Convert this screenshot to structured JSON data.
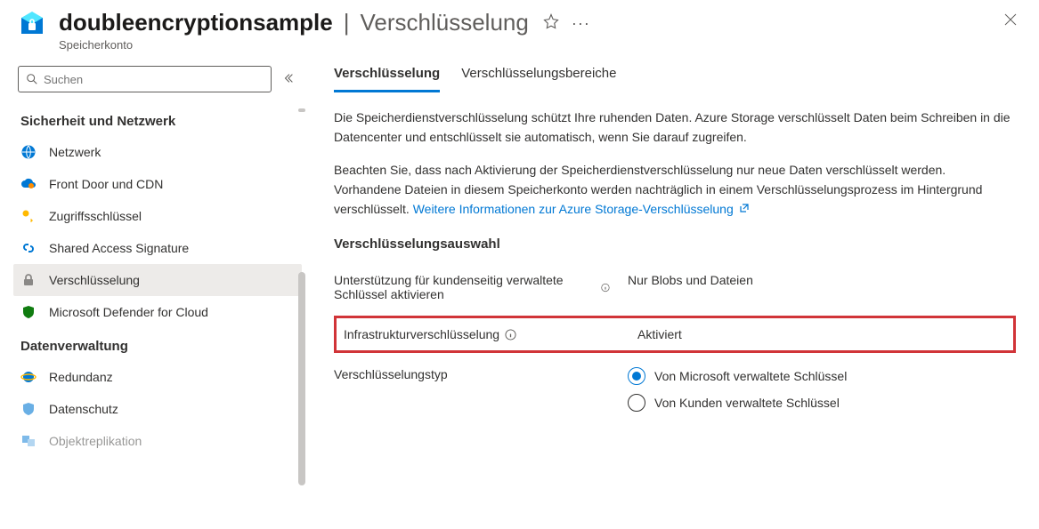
{
  "header": {
    "title": "doubleencryptionsample",
    "section": "Verschlüsselung",
    "subtitle": "Speicherkonto"
  },
  "search": {
    "placeholder": "Suchen"
  },
  "sidebar": {
    "group1": "Sicherheit und Netzwerk",
    "items1": [
      {
        "label": "Netzwerk"
      },
      {
        "label": "Front Door und CDN"
      },
      {
        "label": "Zugriffsschlüssel"
      },
      {
        "label": "Shared Access Signature"
      },
      {
        "label": "Verschlüsselung"
      },
      {
        "label": "Microsoft Defender for Cloud"
      }
    ],
    "group2": "Datenverwaltung",
    "items2": [
      {
        "label": "Redundanz"
      },
      {
        "label": "Datenschutz"
      },
      {
        "label": "Objektreplikation"
      }
    ]
  },
  "tabs": {
    "t1": "Verschlüsselung",
    "t2": "Verschlüsselungsbereiche"
  },
  "desc": {
    "p1": "Die Speicherdienstverschlüsselung schützt Ihre ruhenden Daten. Azure Storage verschlüsselt Daten beim Schreiben in die Datencenter und entschlüsselt sie automatisch, wenn Sie darauf zugreifen.",
    "p2a": "Beachten Sie, dass nach Aktivierung der Speicherdienstverschlüsselung nur neue Daten verschlüsselt werden. Vorhandene Dateien in diesem Speicherkonto werden nachträglich in einem Verschlüsselungsprozess im Hintergrund verschlüsselt. ",
    "p2link": "Weitere Informationen zur Azure Storage-Verschlüsselung"
  },
  "form": {
    "heading": "Verschlüsselungsauswahl",
    "f1label": "Unterstützung für kundenseitig verwaltete Schlüssel aktivieren",
    "f1value": "Nur Blobs und Dateien",
    "f2label": "Infrastrukturverschlüsselung",
    "f2value": "Aktiviert",
    "f3label": "Verschlüsselungstyp",
    "r1": "Von Microsoft verwaltete Schlüssel",
    "r2": "Von Kunden verwaltete Schlüssel"
  }
}
